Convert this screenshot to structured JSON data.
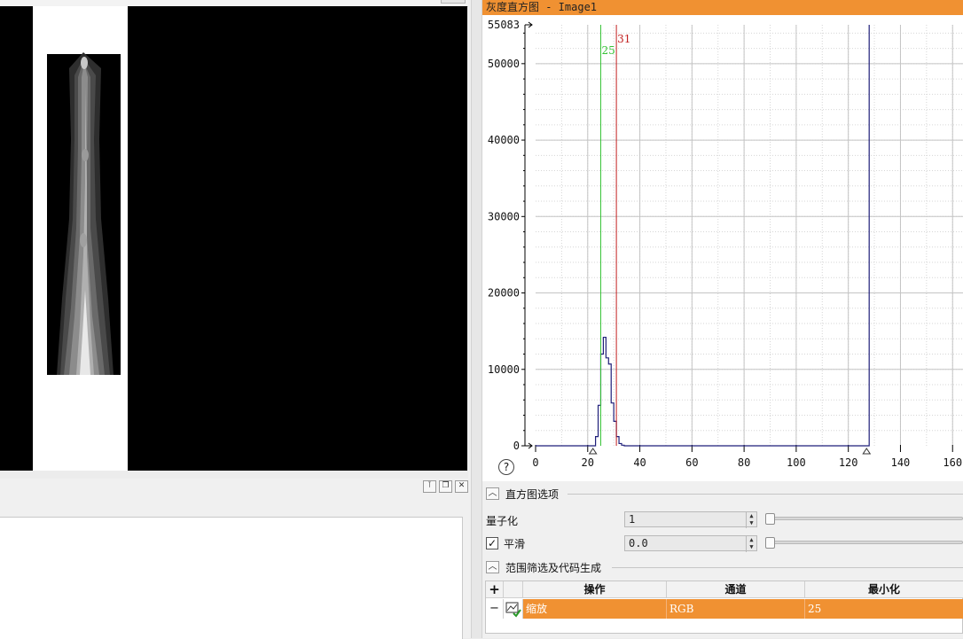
{
  "histogram_window": {
    "title": "灰度直方图 - Image1"
  },
  "chart_data": {
    "type": "area",
    "title": "",
    "xlabel": "",
    "ylabel": "",
    "x_ticks": [
      0,
      20,
      40,
      60,
      80,
      100,
      120,
      140,
      160
    ],
    "y_ticks": [
      0,
      10000,
      20000,
      30000,
      40000,
      50000
    ],
    "y_max_label": "55083",
    "xlim": [
      0,
      164
    ],
    "ylim": [
      0,
      55083
    ],
    "grid": true,
    "series": [
      {
        "color": "#1f1f7a",
        "x": [
          0,
          22,
          23,
          24,
          25,
          26,
          27,
          28,
          29,
          30,
          31,
          32,
          33,
          34,
          35,
          126,
          127,
          128
        ],
        "y": [
          0,
          0,
          1200,
          5300,
          12000,
          14200,
          11500,
          10700,
          5600,
          3200,
          1200,
          300,
          80,
          0,
          0,
          0,
          0,
          55083
        ]
      }
    ],
    "markers": [
      {
        "label": "25",
        "value": 25,
        "color": "#36c236"
      },
      {
        "label": "31",
        "value": 31,
        "color": "#c22020"
      }
    ],
    "range_handles": [
      22,
      127
    ]
  },
  "histogram_options": {
    "section_title": "直方图选项",
    "quantize_label": "量子化",
    "quantize_value": "1",
    "smooth_label": "平滑",
    "smooth_checked": true,
    "smooth_value": "0.0"
  },
  "range_section": {
    "section_title": "范围筛选及代码生成",
    "add_label": "+",
    "remove_label": "−",
    "columns": [
      "操作",
      "通道",
      "最小化"
    ],
    "rows": [
      {
        "operation": "缩放",
        "channel": "RGB",
        "min": "25"
      }
    ]
  },
  "help_label": "?",
  "colors": {
    "accent_orange": "#f09132",
    "histogram_line": "#1f1f7a",
    "marker_green": "#36c236",
    "marker_red": "#c22020"
  }
}
